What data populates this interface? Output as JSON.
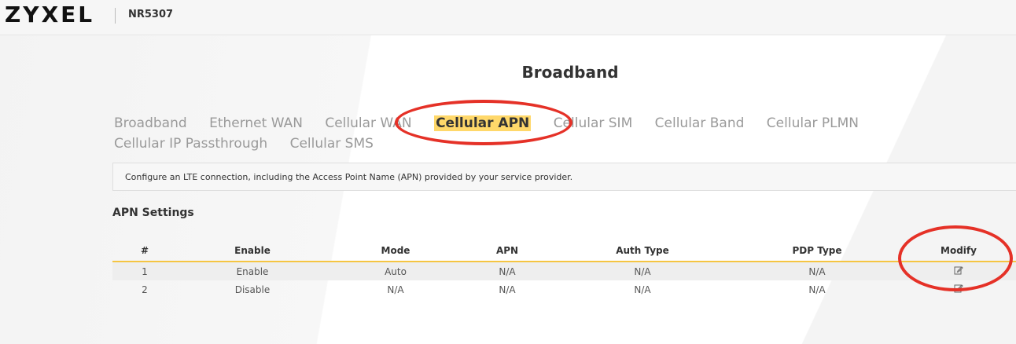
{
  "header": {
    "logo": "ZYXEL",
    "model": "NR5307"
  },
  "page": {
    "title": "Broadband"
  },
  "tabs": [
    {
      "label": "Broadband",
      "active": false
    },
    {
      "label": "Ethernet WAN",
      "active": false
    },
    {
      "label": "Cellular WAN",
      "active": false
    },
    {
      "label": "Cellular APN",
      "active": true
    },
    {
      "label": "Cellular SIM",
      "active": false
    },
    {
      "label": "Cellular Band",
      "active": false
    },
    {
      "label": "Cellular PLMN",
      "active": false
    },
    {
      "label": "Cellular IP Passthrough",
      "active": false
    },
    {
      "label": "Cellular SMS",
      "active": false
    }
  ],
  "description": "Configure an LTE connection, including the Access Point Name (APN) provided by your service provider.",
  "apn_settings": {
    "title": "APN Settings",
    "columns": [
      "#",
      "Enable",
      "Mode",
      "APN",
      "Auth Type",
      "PDP Type",
      "Modify"
    ],
    "rows": [
      {
        "num": "1",
        "enable": "Enable",
        "mode": "Auto",
        "apn": "N/A",
        "auth": "N/A",
        "pdp": "N/A",
        "modify_icon": "edit-icon"
      },
      {
        "num": "2",
        "enable": "Disable",
        "mode": "N/A",
        "apn": "N/A",
        "auth": "N/A",
        "pdp": "N/A",
        "modify_icon": "edit-icon"
      }
    ]
  },
  "colors": {
    "accent": "#f5c542",
    "highlight": "#ffd86a",
    "annotation": "#e53127"
  }
}
